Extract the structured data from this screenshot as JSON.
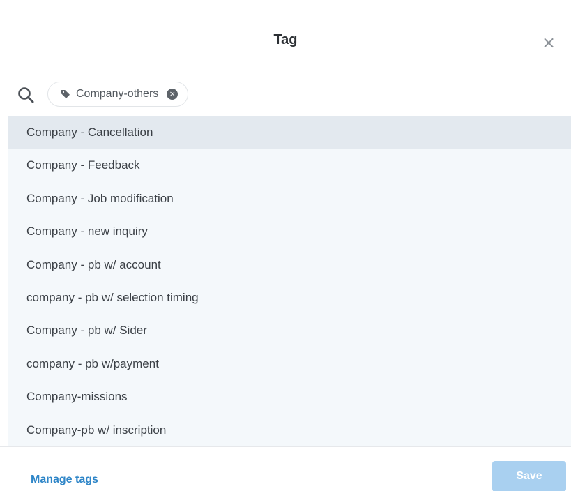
{
  "dialog": {
    "title": "Tag",
    "close_label": "×"
  },
  "search": {
    "selected_tag": "Company-others",
    "remove_glyph": "×",
    "value": "",
    "placeholder": ""
  },
  "tags": [
    "Company - Cancellation",
    "Company - Feedback",
    "Company - Job modification",
    "Company - new inquiry",
    "Company - pb w/ account",
    "company - pb w/ selection timing",
    "Company - pb w/ Sider",
    "company - pb w/payment",
    "Company-missions",
    "Company-pb w/ inscription"
  ],
  "highlighted_index": 0,
  "footer": {
    "manage_label": "Manage tags",
    "save_label": "Save"
  },
  "colors": {
    "accent": "#2f86c8",
    "save_disabled": "#a9d0f0",
    "list_background": "#f4f8fb",
    "highlight": "#e3e9ef"
  },
  "icons": [
    "search-icon",
    "tag-icon",
    "close-icon",
    "remove-tag-icon"
  ]
}
